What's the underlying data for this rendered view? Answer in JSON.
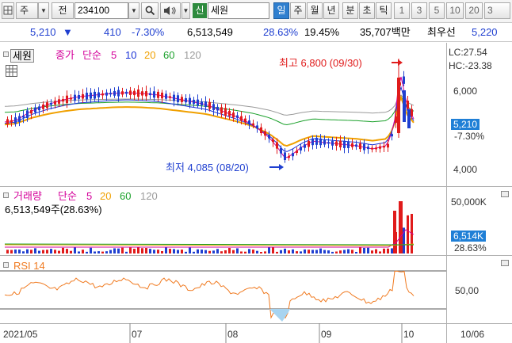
{
  "toolbar": {
    "type_label": "주",
    "jeon_label": "전",
    "code": "234100",
    "sin_badge": "신",
    "stock_name": "세원",
    "periods": [
      "일",
      "주",
      "월",
      "년",
      "분",
      "초",
      "틱"
    ],
    "selected_period": "일",
    "intervals": [
      "1",
      "3",
      "5",
      "10",
      "20",
      "3"
    ]
  },
  "quote": {
    "price": "5,210",
    "change": "410",
    "change_pct": "-7.30%",
    "volume": "6,513,549",
    "turnover_pct": "28.63%",
    "rate2": "19.45%",
    "amount": "35,707백만",
    "best_ask_label": "최우선",
    "best_ask": "5,220"
  },
  "price_panel": {
    "mode_label": "세원",
    "close_label": "종가",
    "ma_label": "단순",
    "ma_periods": [
      {
        "value": "5",
        "color": "#d4009a"
      },
      {
        "value": "10",
        "color": "#1a33d6"
      },
      {
        "value": "20",
        "color": "#f0a000"
      },
      {
        "value": "60",
        "color": "#1aa02a"
      },
      {
        "value": "120",
        "color": "#9a9a9a"
      }
    ],
    "lc": "LC:27.54",
    "hc": "HC:-23.38",
    "high_annotation": "최고 6,800 (09/30)",
    "low_annotation": "최저 4,085 (08/20)",
    "y_ticks": [
      "6,000",
      "4,000"
    ],
    "current_price": "5,210",
    "current_pct": "-7.30%"
  },
  "volume_panel": {
    "title": "거래량",
    "ma_label": "단순",
    "ma_periods": [
      {
        "value": "5",
        "color": "#d4009a"
      },
      {
        "value": "20",
        "color": "#f0a000"
      },
      {
        "value": "60",
        "color": "#1aa02a"
      },
      {
        "value": "120",
        "color": "#9a9a9a"
      }
    ],
    "summary": "6,513,549주(28.63%)",
    "y_tick": "50,000K",
    "current_volume": "6,514K",
    "current_pct": "28.63%"
  },
  "rsi_panel": {
    "title": "RSI 14",
    "y_tick": "50,00"
  },
  "x_axis": {
    "labels": [
      "2021/05",
      "07",
      "08",
      "09",
      "10",
      "10/06"
    ]
  },
  "colors": {
    "up": "#e01b1b",
    "down": "#1f3fd0",
    "selected": "#2f7fcf",
    "rsi_line": "#f07a20"
  }
}
